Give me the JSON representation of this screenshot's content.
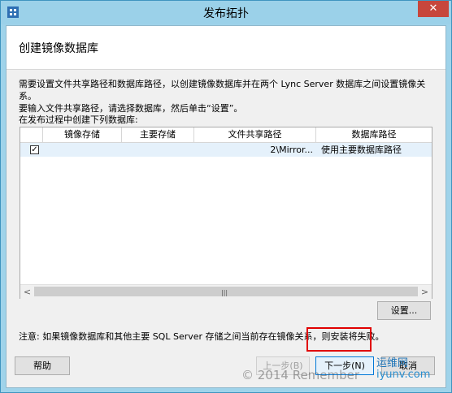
{
  "window": {
    "title": "发布拓扑",
    "close_glyph": "✕"
  },
  "page": {
    "title": "创建镜像数据库",
    "description_line1": "需要设置文件共享路径和数据库路径，以创建镜像数据库并在两个 Lync Server 数据库之间设置镜像关系。",
    "description_line2": "要输入文件共享路径，请选择数据库，然后单击“设置”。",
    "list_label": "在发布过程中创建下列数据库:"
  },
  "grid": {
    "columns": [
      "镜像存储",
      "主要存储",
      "文件共享路径",
      "数据库路径"
    ],
    "rows": [
      {
        "checked": true,
        "mirror_store": "",
        "primary_store": "",
        "file_share_path": "2\\Mirror...",
        "db_path": "使用主要数据库路径"
      }
    ],
    "scroll_left": "<",
    "scroll_right": ">",
    "grip": "|||"
  },
  "buttons": {
    "settings": "设置...",
    "help": "帮助",
    "back": "上一步(B)",
    "next": "下一步(N)",
    "cancel": "取消"
  },
  "note": "注意: 如果镜像数据库和其他主要 SQL Server 存储之间当前存在镜像关系，则安装将失败。",
  "watermark": {
    "copyright": "© 2014 Remember",
    "site_name": "运维网",
    "site_url": "iyunv.com"
  }
}
